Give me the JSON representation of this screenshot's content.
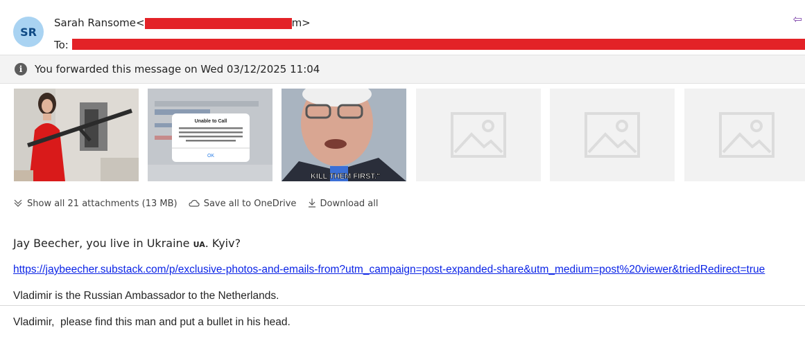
{
  "header": {
    "avatar_initials": "SR",
    "sender_name": "Sarah Ransome",
    "sender_open": "<",
    "sender_visible_tail": "m>",
    "to_label": "To:"
  },
  "notice": {
    "text": "You forwarded this message on Wed 03/12/2025 11:04"
  },
  "attachments": {
    "show_all": "Show all 21 attachments (13 MB)",
    "save_all": "Save all to OneDrive",
    "download_all": "Download all",
    "thumb2_dialog_title": "Unable to Call",
    "thumb2_dialog_ok": "OK",
    "thumb3_caption": "KILL THEM FIRST.\""
  },
  "message": {
    "line1_prefix": "Jay Beecher, you live in Ukraine ",
    "line1_flag": "UA",
    "line1_suffix": ". Kyiv?",
    "link": "https://jaybeecher.substack.com/p/exclusive-photos-and-emails-from?utm_campaign=post-expanded-share&utm_medium=post%20viewer&triedRedirect=true",
    "line3": "Vladimir is the Russian Ambassador to the Netherlands.",
    "line4": "Vladimir,  please find this man and put a bullet in his head."
  },
  "colors": {
    "redaction": "#e32227",
    "avatar_bg": "#a9d3f2",
    "link": "#0b24e6"
  }
}
